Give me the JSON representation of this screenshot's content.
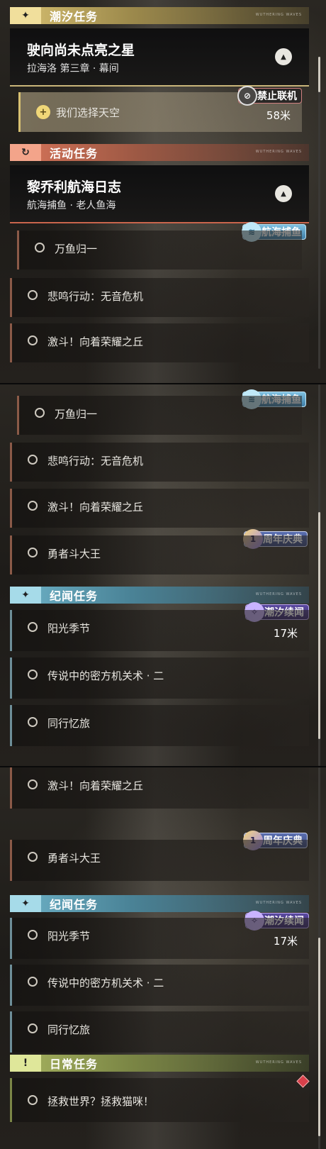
{
  "sections": {
    "tidal": {
      "label": "潮汐任务",
      "brand": "WUTHERING WAVES"
    },
    "event": {
      "label": "活动任务",
      "brand": "WUTHERING WAVES"
    },
    "chronicle": {
      "label": "纪闻任务",
      "brand": "WUTHERING WAVES"
    },
    "daily": {
      "label": "日常任务",
      "brand": "WUTHERING WAVES"
    }
  },
  "panel1": {
    "tidal_quest": {
      "title": "驶向尚未点亮之星",
      "subtitle": "拉海洛 第三章 · 幕间"
    },
    "tracked_task": {
      "name": "我们选择天空",
      "distance": "58米",
      "badge": "禁止联机"
    },
    "event_quest": {
      "title": "黎乔利航海日志",
      "subtitle": "航海捕鱼 · 老人鱼海"
    },
    "fish_badge": "航海捕鱼",
    "tasks": [
      "万鱼归一",
      "悲鸣行动：无音危机",
      "激斗！向着荣耀之丘"
    ]
  },
  "panel2": {
    "fish_badge": "航海捕鱼",
    "tasks": [
      "万鱼归一",
      "悲鸣行动：无音危机",
      "激斗！向着荣耀之丘",
      "勇者斗大王"
    ],
    "anniv_badge": "周年庆典",
    "chronicle_badge": "潮汐续闻",
    "chronicle_tasks": [
      {
        "name": "阳光季节",
        "distance": "17米"
      },
      {
        "name": "传说中的密方机关术 · 二",
        "distance": ""
      },
      {
        "name": "同行忆旅",
        "distance": ""
      }
    ]
  },
  "panel3": {
    "tasks": [
      "激斗！向着荣耀之丘",
      "勇者斗大王"
    ],
    "anniv_badge": "周年庆典",
    "chronicle_badge": "潮汐续闻",
    "chronicle_tasks": [
      {
        "name": "阳光季节",
        "distance": "17米"
      },
      {
        "name": "传说中的密方机关术 · 二",
        "distance": ""
      },
      {
        "name": "同行忆旅",
        "distance": ""
      }
    ],
    "daily_tasks": [
      "拯救世界？拯救猫咪！"
    ]
  }
}
